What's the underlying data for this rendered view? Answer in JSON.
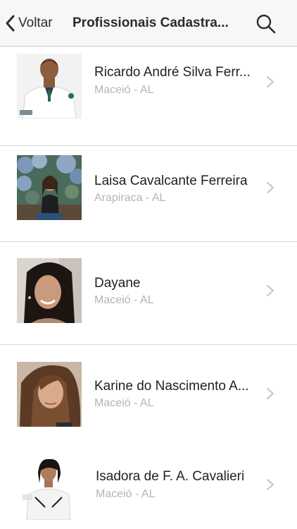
{
  "header": {
    "back_label": "Voltar",
    "title": "Profissionais Cadastra...",
    "back_icon": "chevron-left-icon",
    "search_icon": "search-icon"
  },
  "professionals": [
    {
      "name": "Ricardo André Silva Ferr...",
      "city": "Maceió - AL"
    },
    {
      "name": "Laisa Cavalcante Ferreira",
      "city": "Arapiraca - AL"
    },
    {
      "name": "Dayane",
      "city": "Maceió - AL"
    },
    {
      "name": "Karine do Nascimento A...",
      "city": "Maceió - AL"
    },
    {
      "name": "Isadora de F. A. Cavalieri",
      "city": "Maceió - AL"
    }
  ],
  "colors": {
    "nav_background": "#f7f7f7",
    "name_text": "#222222",
    "city_text": "#b4b4b4",
    "divider": "#d9d9d9"
  }
}
